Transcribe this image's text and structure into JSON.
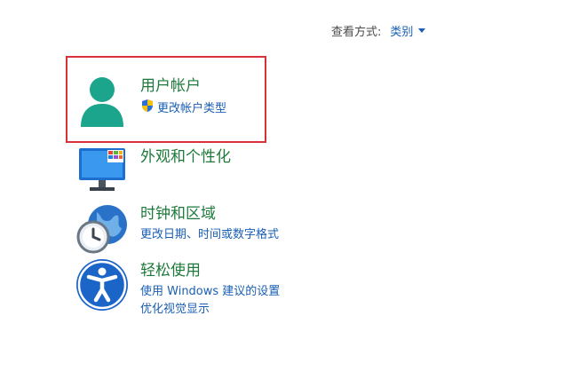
{
  "view_by": {
    "label": "查看方式:",
    "value": "类别"
  },
  "items": [
    {
      "title": "用户帐户",
      "icon": "user-account-icon",
      "links": [
        "更改帐户类型"
      ]
    },
    {
      "title": "外观和个性化",
      "icon": "appearance-personalization-icon",
      "links": []
    },
    {
      "title": "时钟和区域",
      "icon": "clock-region-icon",
      "links": [
        "更改日期、时间或数字格式"
      ]
    },
    {
      "title": "轻松使用",
      "icon": "ease-of-access-icon",
      "links": [
        "使用 Windows 建议的设置",
        "优化视觉显示"
      ]
    }
  ],
  "colors": {
    "title_green": "#1d7a3a",
    "link_blue": "#1a5fb4",
    "highlight_red": "#d9303a",
    "user_icon_teal": "#1ba58c"
  }
}
